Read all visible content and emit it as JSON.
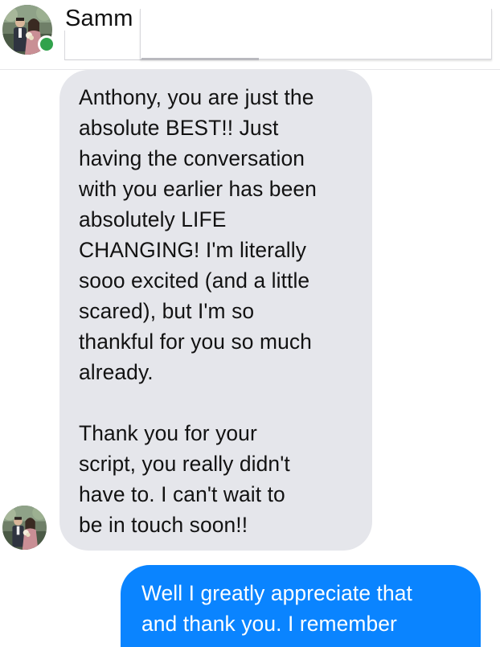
{
  "header": {
    "contact_name": "Samm",
    "online": true,
    "avatar_icon": "profile-photo-icon",
    "online_color": "#31a24c"
  },
  "messages": {
    "received": {
      "lines_p1": [
        "Anthony, you are just the",
        "absolute BEST!! Just",
        "having the conversation",
        "with you earlier has been",
        "absolutely LIFE",
        "CHANGING! I'm literally",
        "sooo excited (and a little",
        "scared), but I'm so",
        "thankful for you so much",
        "already."
      ],
      "lines_p2": [
        "Thank you for your",
        "script, you really didn't",
        "have to.  I can't wait to",
        "be in touch soon!!"
      ],
      "bubble_color": "#e5e6eb"
    },
    "sent": {
      "lines": [
        "Well I greatly appreciate that",
        "and thank you. I remember"
      ],
      "bubble_color": "#0a84ff"
    }
  }
}
